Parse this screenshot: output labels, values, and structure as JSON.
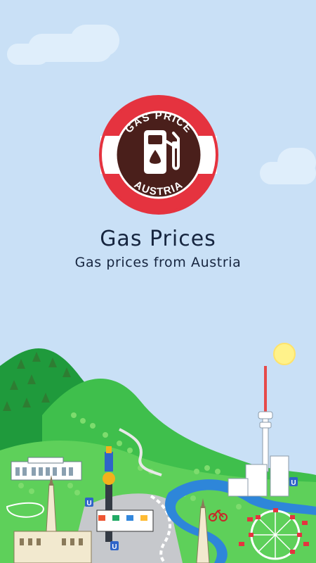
{
  "app": {
    "title": "Gas Prices",
    "subtitle": "Gas prices from Austria"
  },
  "logo": {
    "top_text": "GAS PRICE",
    "bottom_text": "AUSTRIA",
    "icon": "fuel-pump-icon",
    "colors": {
      "ring_red": "#e5333f",
      "ring_white": "#ffffff",
      "center_brown": "#4a1f1b"
    }
  },
  "scene": {
    "subway_sign": "U",
    "colors": {
      "sky": "#c9e0f6",
      "hill_dark": "#1f9a3c",
      "hill_light": "#3fbf4c",
      "river": "#2e86d9",
      "sun": "#fff28a"
    }
  }
}
